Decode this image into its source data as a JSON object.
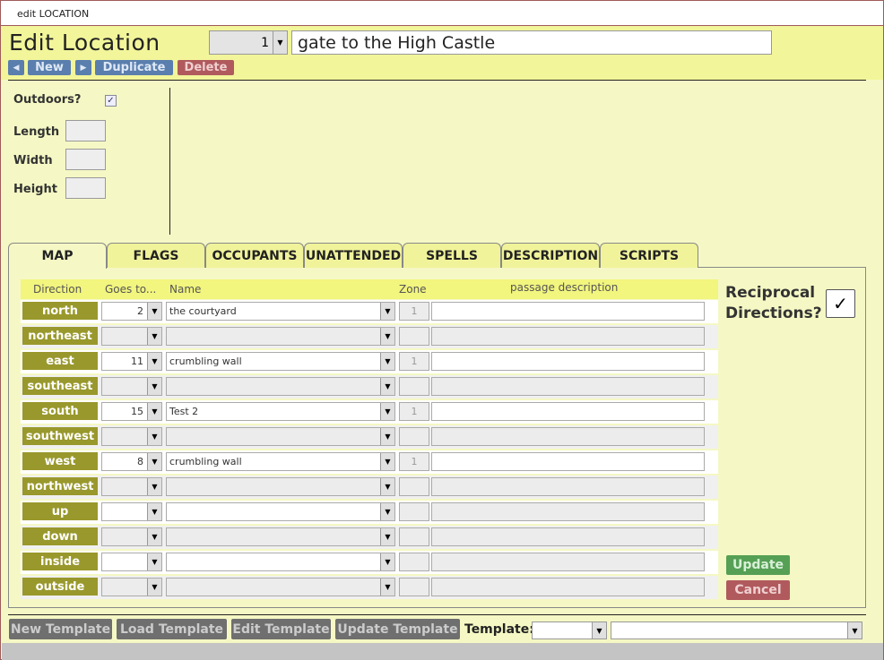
{
  "window": {
    "title": "edit LOCATION"
  },
  "header": {
    "title": "Edit Location",
    "record_id": "1",
    "record_name": "gate to the High Castle",
    "buttons": {
      "new": "New",
      "duplicate": "Duplicate",
      "delete": "Delete"
    }
  },
  "props": {
    "outdoors_label": "Outdoors?",
    "outdoors_checked": true,
    "length_label": "Length",
    "width_label": "Width",
    "height_label": "Height",
    "length": "",
    "width": "",
    "height": ""
  },
  "tabs": [
    "MAP",
    "FLAGS",
    "OCCUPANTS",
    "UNATTENDED",
    "SPELLS",
    "DESCRIPTION",
    "SCRIPTS"
  ],
  "active_tab": "MAP",
  "map": {
    "columns": {
      "direction": "Direction",
      "goes_to": "Goes to...",
      "name": "Name",
      "zone": "Zone",
      "passage": "passage description"
    },
    "rows": [
      {
        "direction": "north",
        "goes_to": "2",
        "name": "the courtyard",
        "zone": "1",
        "passage": ""
      },
      {
        "direction": "northeast",
        "goes_to": "",
        "name": "",
        "zone": "",
        "passage": ""
      },
      {
        "direction": "east",
        "goes_to": "11",
        "name": "crumbling wall",
        "zone": "1",
        "passage": ""
      },
      {
        "direction": "southeast",
        "goes_to": "",
        "name": "",
        "zone": "",
        "passage": ""
      },
      {
        "direction": "south",
        "goes_to": "15",
        "name": "Test 2",
        "zone": "1",
        "passage": ""
      },
      {
        "direction": "southwest",
        "goes_to": "",
        "name": "",
        "zone": "",
        "passage": ""
      },
      {
        "direction": "west",
        "goes_to": "8",
        "name": "crumbling wall",
        "zone": "1",
        "passage": ""
      },
      {
        "direction": "northwest",
        "goes_to": "",
        "name": "",
        "zone": "",
        "passage": ""
      },
      {
        "direction": "up",
        "goes_to": "",
        "name": "",
        "zone": "",
        "passage": ""
      },
      {
        "direction": "down",
        "goes_to": "",
        "name": "",
        "zone": "",
        "passage": ""
      },
      {
        "direction": "inside",
        "goes_to": "",
        "name": "",
        "zone": "",
        "passage": ""
      },
      {
        "direction": "outside",
        "goes_to": "",
        "name": "",
        "zone": "",
        "passage": ""
      }
    ],
    "reciprocal_label_1": "Reciprocal",
    "reciprocal_label_2": "Directions?",
    "reciprocal_checked": true,
    "check_mark": "✓",
    "update": "Update",
    "cancel": "Cancel"
  },
  "footer": {
    "new_template": "New Template",
    "load_template": "Load Template",
    "edit_template": "Edit Template",
    "update_template": "Update Template",
    "template_label": "Template:",
    "template_id": "",
    "template_name": ""
  },
  "colors": {
    "header": "#f2f59a",
    "body": "#f5f8c4",
    "direction_btn": "#99982c",
    "blue_btn": "#5a7fae",
    "red_btn": "#b05a5e",
    "green_btn": "#55a055"
  }
}
